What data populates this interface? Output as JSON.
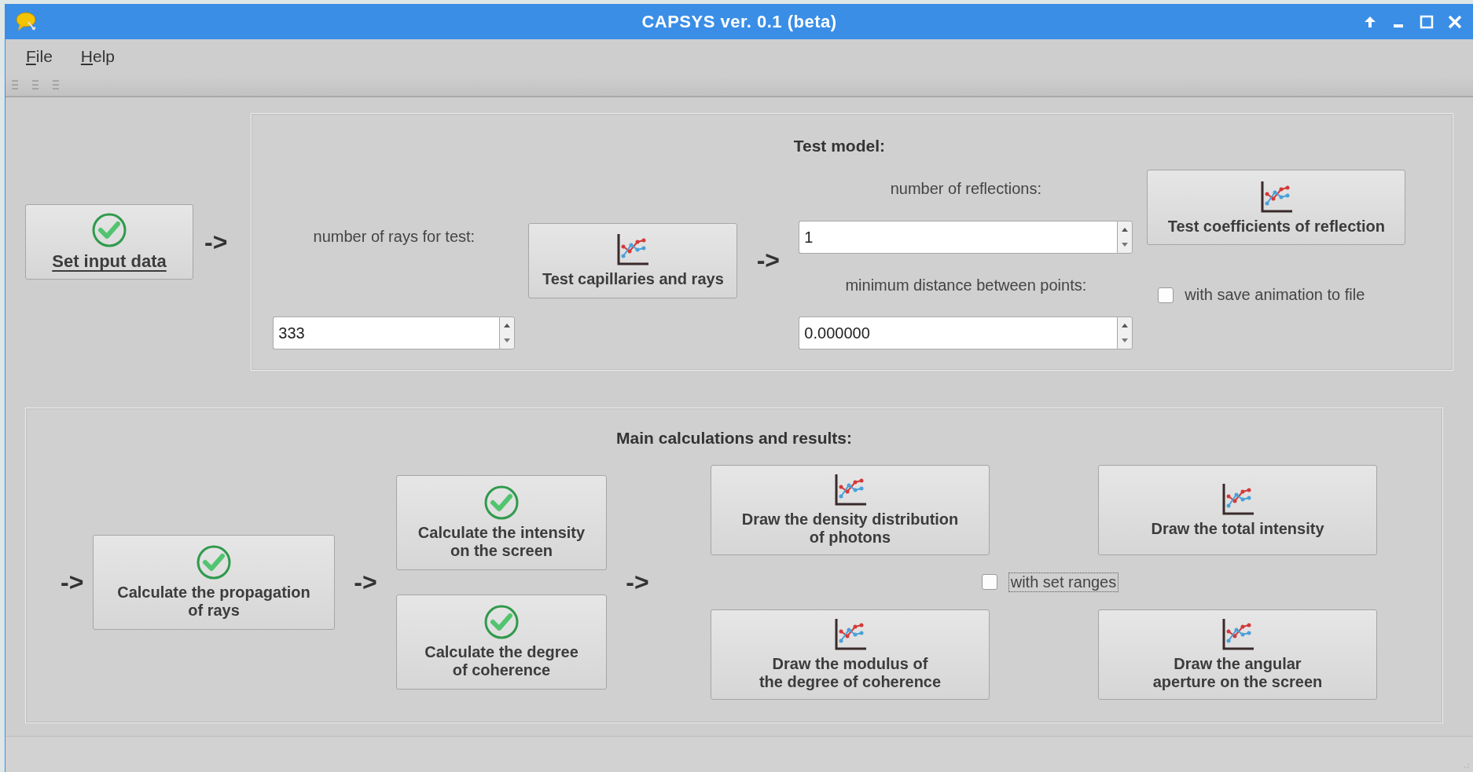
{
  "window": {
    "title": "CAPSYS ver. 0.1 (beta)"
  },
  "menu": [
    {
      "label": "File"
    },
    {
      "label": "Help"
    }
  ],
  "input_step": {
    "label": "Set input data",
    "done": true,
    "arrow": "->"
  },
  "test_model": {
    "title": "Test model:",
    "rays_label": "number of rays for test:",
    "rays_value": "333",
    "capillaries_button": "Test capillaries and rays",
    "arrow": "->",
    "reflections_label": "number of reflections:",
    "reflections_value": "1",
    "distance_label": "minimum distance between points:",
    "distance_value": "0.000000",
    "coefficients_button": "Test coefficients of reflection",
    "save_animation": {
      "label": "with save animation to file",
      "checked": false
    }
  },
  "main": {
    "title": "Main calculations and results:",
    "arrows": [
      "->",
      "->",
      "->"
    ],
    "propagation": {
      "label": "Calculate the propagation\nof rays",
      "done": true
    },
    "intensity": {
      "label": "Calculate the intensity\non the screen",
      "done": true
    },
    "coherence": {
      "label": "Calculate the degree\nof coherence",
      "done": true
    },
    "draw_buttons": [
      {
        "label": "Draw the density distribution\nof photons"
      },
      {
        "label": "Draw the total intensity"
      },
      {
        "label": "Draw the modulus of\nthe degree of coherence"
      },
      {
        "label": "Draw the angular\naperture on the screen"
      }
    ],
    "set_ranges": {
      "label": "with set ranges",
      "checked": false
    }
  }
}
